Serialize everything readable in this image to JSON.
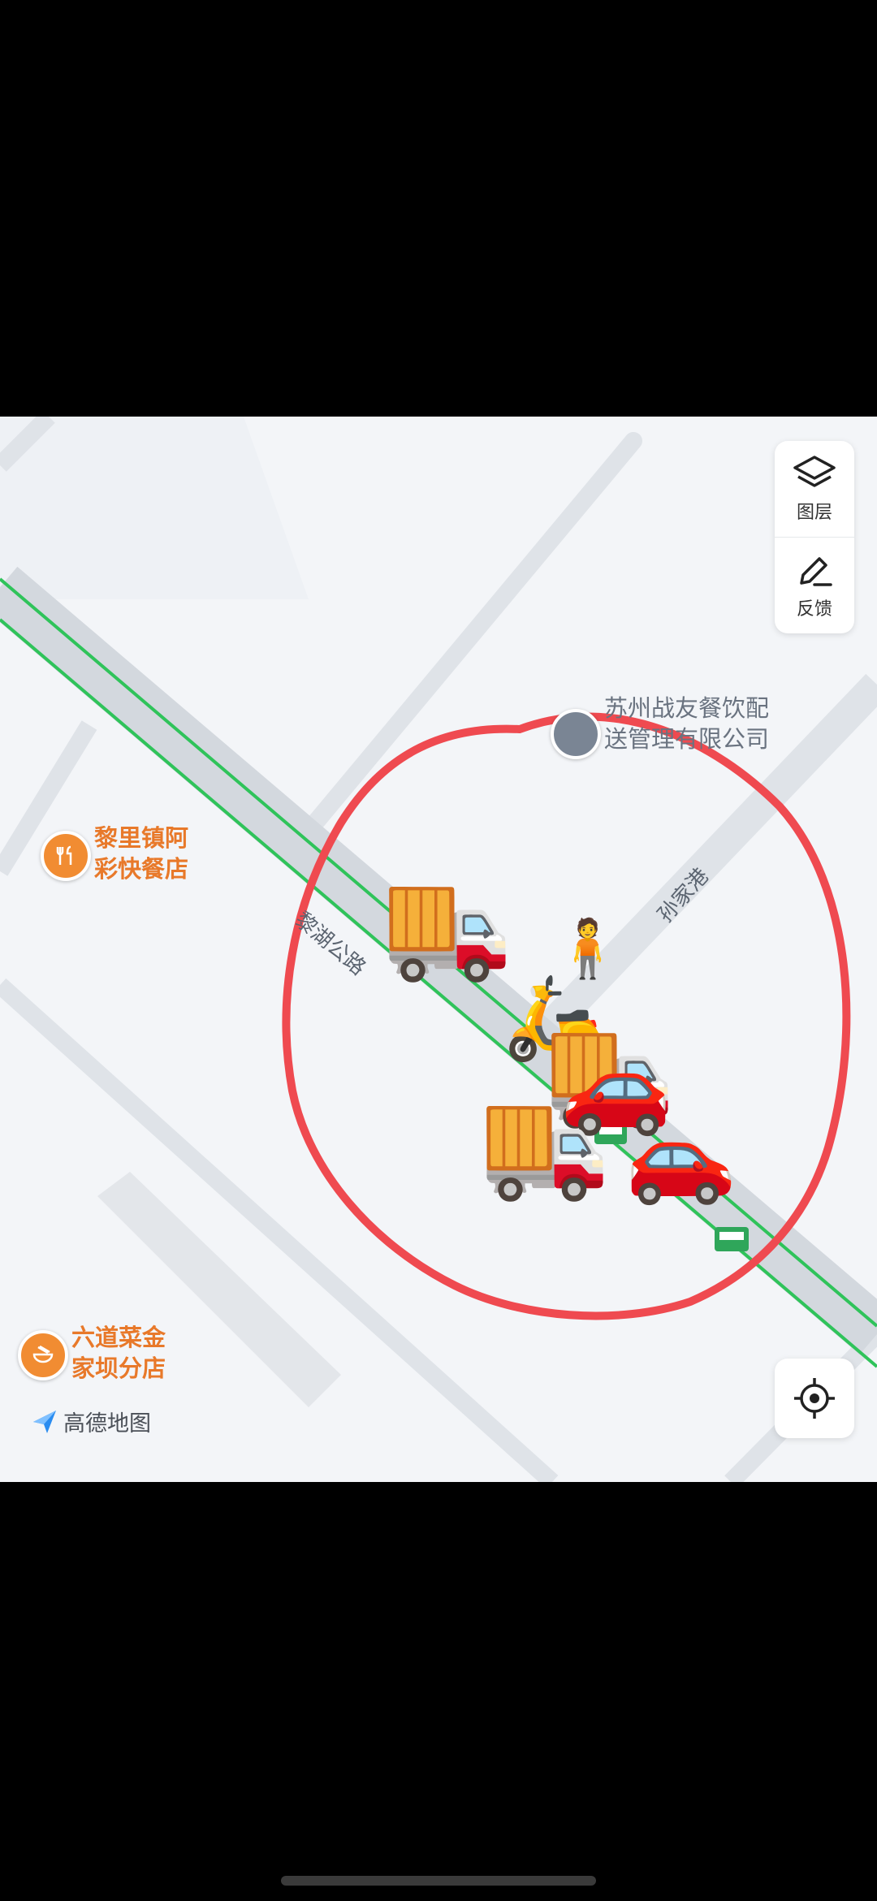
{
  "map": {
    "provider_logo": "高德地图",
    "pois": [
      {
        "name": "黎里镇阿\n彩快餐店",
        "icon": "fork-knife-icon"
      },
      {
        "name": "六道菜金\n家坝分店",
        "icon": "noodle-bowl-icon"
      }
    ],
    "company": {
      "name": "苏州战友餐饮配\n送管理有限公司",
      "icon": "building-icon"
    },
    "roads": [
      {
        "name": "黎湖公路"
      },
      {
        "name": "孙家港"
      }
    ],
    "controls": {
      "layers_label": "图层",
      "feedback_label": "反馈"
    },
    "route_color": "#2fc35a",
    "annotation_color": "#ef4a50",
    "vehicles": [
      "delivery-truck",
      "delivery-truck",
      "delivery-truck",
      "red-car",
      "red-car",
      "motor-scooter",
      "person"
    ]
  }
}
